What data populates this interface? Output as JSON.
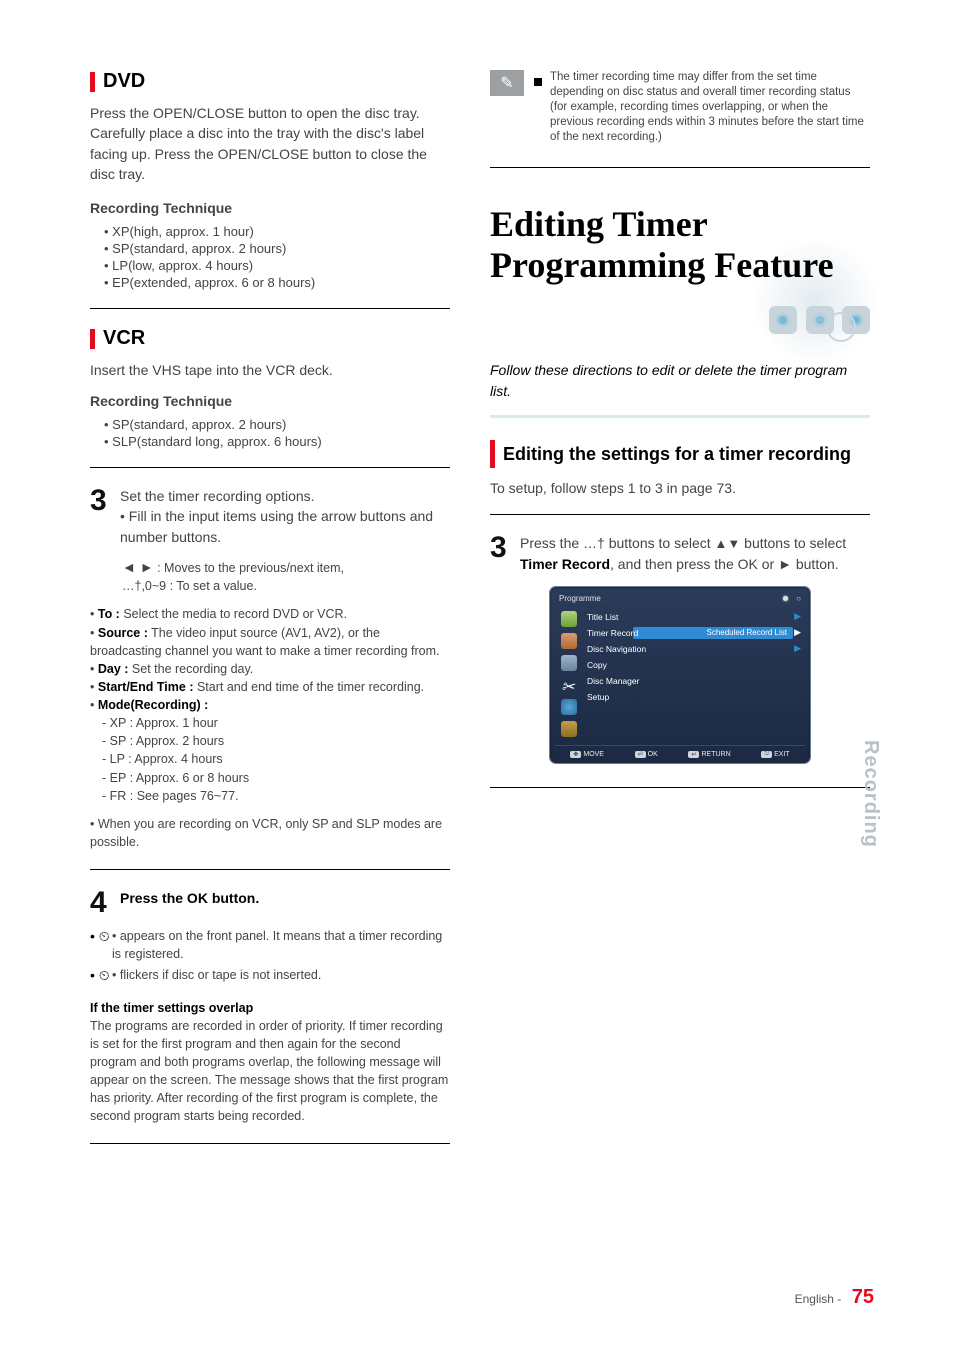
{
  "left": {
    "dvd_heading": "DVD",
    "dvd_body": "Press the OPEN/CLOSE button to open the disc tray. Carefully place a disc into the tray with the disc's label facing up. Press the OPEN/CLOSE button to close the disc tray.",
    "dvd_tech_label": "Recording Technique",
    "dvd_tech_modes": [
      "XP(high, approx. 1 hour)",
      "SP(standard, approx. 2 hours)",
      "LP(low, approx. 4 hours)",
      "EP(extended, approx. 6 or 8 hours)"
    ],
    "vcr_heading": "VCR",
    "vcr_body": "Insert the VHS tape into the VCR deck.",
    "vcr_tech_label": "Recording Technique",
    "vcr_tech_modes": [
      "SP(standard, approx. 2 hours)",
      "SLP(standard long, approx. 6 hours)"
    ],
    "step3_num": "3",
    "step3_text_a": "Set the timer recording options.",
    "step3_text_b": "Fill in the input items using the arrow buttons and number buttons.",
    "step3_arrows": "◄ ►",
    "step3_movements": ": Moves to the previous/next item,",
    "step3_updown_label": "…†,0~9 : To set a value.",
    "fields_label_to": "To :",
    "fields_to": " Select the media to record DVD or VCR.",
    "fields_label_source": "Source :",
    "fields_source": " The video input source (AV1, AV2), or the broadcasting channel you want to make a timer recording from.",
    "fields_label_day": "Day :",
    "fields_day": " Set the recording day.",
    "fields_label_time": "Start/End Time :",
    "fields_time": " Start and end time of the timer recording.",
    "fields_label_mode": "Mode(Recording) :",
    "fields_xp": "XP : Approx. 1 hour",
    "fields_sp": "SP : Approx. 2 hours",
    "fields_lp": "LP : Approx. 4 hours",
    "fields_ep": "EP : Approx. 6 or 8 hours",
    "fields_fr": "FR : See pages 76~77.",
    "vcr_record_note": "When you are recording on VCR, only SP and SLP modes are possible.",
    "step4_num": "4",
    "step4_text_a": "Press the OK button.",
    "step4_indicator_a": "• appears on the front panel. It means that a timer recording is registered.",
    "step4_indicator_b": "• flickers if disc or tape is not inserted.",
    "step4_overlap_bold": "If the timer settings overlap",
    "step4_overlap_text": "The programs are recorded in order of priority. If timer recording is set for the first program and then again for the second program and both programs overlap, the following message will appear on the screen. The message shows that the first program has priority. After recording of the first program is complete, the second program starts being recorded."
  },
  "right": {
    "note_text": "The timer recording time may differ from the set time depending on disc status and overall timer recording status (for example, recording times overlapping, or when the previous recording ends within 3 minutes before the start time of the next recording.)",
    "big_title_1": "Editing Timer",
    "big_title_2": "Programming Feature",
    "lead_text": "Follow these directions to edit or delete the timer program list.",
    "sub_heading": "Editing the settings for a timer recording",
    "sub_body": "To setup, follow steps 1 to 3 in page 73.",
    "step3r_num": "3",
    "step3r_text_a": "Press the …† buttons to select ",
    "step3r_text_b": "Timer Record",
    "step3r_text_c": ", and then press the OK or ",
    "step3r_arrow": "►",
    "step3r_text_d": " button."
  },
  "osd": {
    "topbar_left": "Programme",
    "topbar_right_dot": "○",
    "rows": {
      "title_list": "Title List",
      "timer_record": "Timer Record",
      "timer_sub": "Scheduled Record List",
      "disc_nav": "Disc Navigation",
      "copy": "Copy",
      "disc_mgr": "Disc Manager",
      "setup": "Setup"
    },
    "footer": {
      "move": "MOVE",
      "ok": "OK",
      "return": "RETURN",
      "exit": "EXIT"
    }
  },
  "sidetab": "Recording",
  "page": {
    "lang": "English -",
    "num": "75"
  }
}
